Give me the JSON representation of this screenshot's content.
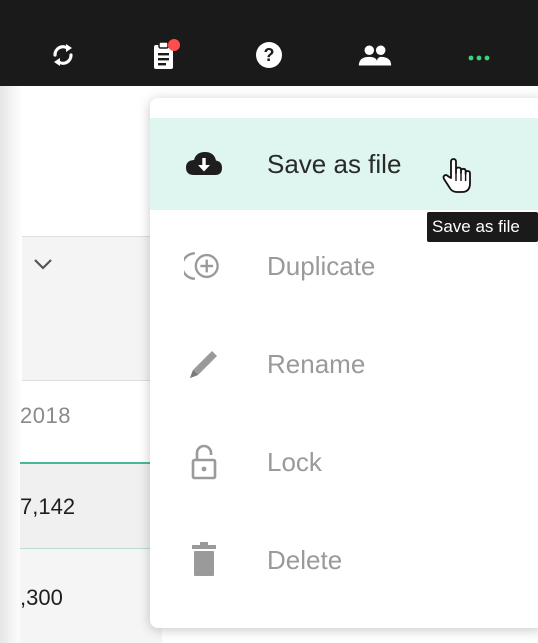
{
  "toolbar": {
    "icons": [
      "sync-icon",
      "clipboard-notification-icon",
      "help-icon",
      "users-icon",
      "more-icon"
    ],
    "accent_color": "#3fd17a",
    "notification_color": "#ff4d4d"
  },
  "background": {
    "year_label": "2018",
    "row1_value": "7,142",
    "row2_value": ",300"
  },
  "menu": {
    "items": [
      {
        "label": "Save as file",
        "icon": "cloud-download-icon",
        "state": "hovered"
      },
      {
        "label": "Duplicate",
        "icon": "duplicate-icon",
        "state": "disabled"
      },
      {
        "label": "Rename",
        "icon": "pencil-icon",
        "state": "disabled"
      },
      {
        "label": "Lock",
        "icon": "lock-open-icon",
        "state": "disabled"
      },
      {
        "label": "Delete",
        "icon": "trash-icon",
        "state": "disabled"
      }
    ],
    "highlight_color": "#dff5ef"
  },
  "tooltip": {
    "text": "Save as file"
  }
}
